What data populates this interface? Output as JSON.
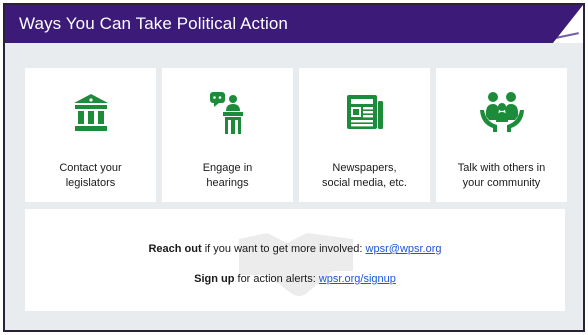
{
  "header": {
    "title": "Ways You Can Take Political Action"
  },
  "colors": {
    "brand_purple": "#3b1a78",
    "icon_green": "#1d8c3a",
    "link_blue": "#1a57d6",
    "background": "#e9ecef"
  },
  "cards": [
    {
      "icon": "government-building-icon",
      "label": "Contact your\nlegislators"
    },
    {
      "icon": "speaker-at-podium-icon",
      "label": "Engage in\nhearings"
    },
    {
      "icon": "newspaper-icon",
      "label": "Newspapers,\nsocial media, etc."
    },
    {
      "icon": "community-people-icon",
      "label": "Talk with others in\nyour community"
    }
  ],
  "actions": {
    "reach_out_bold": "Reach out",
    "reach_out_text": " if you want to get more involved: ",
    "reach_out_link": "wpsr@wpsr.org",
    "sign_up_bold": "Sign up",
    "sign_up_text": " for action alerts: ",
    "sign_up_link": "wpsr.org/signup",
    "background_icon": "handshake-icon"
  }
}
